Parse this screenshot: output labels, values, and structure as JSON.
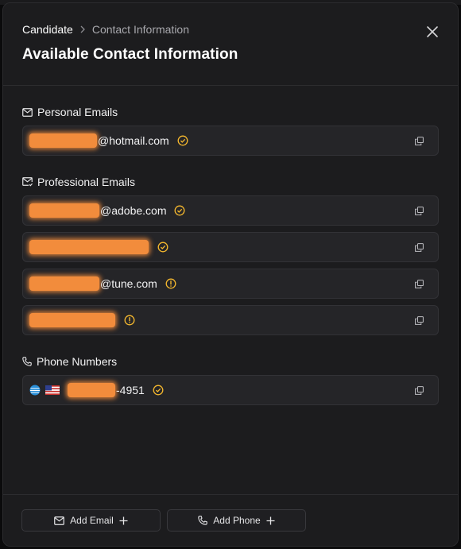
{
  "breadcrumb": {
    "root": "Candidate",
    "current": "Contact Information"
  },
  "title": "Available Contact Information",
  "sections": {
    "personal": {
      "title": "Personal Emails",
      "icon": "mail-icon",
      "items": [
        {
          "suffix": "@hotmail.com",
          "status": "verified"
        }
      ]
    },
    "professional": {
      "title": "Professional Emails",
      "icon": "mail-check-icon",
      "items": [
        {
          "suffix": "@adobe.com",
          "status": "verified"
        },
        {
          "suffix": "",
          "status": "verified"
        },
        {
          "suffix": "@tune.com",
          "status": "warning"
        },
        {
          "suffix": "",
          "status": "warning"
        }
      ]
    },
    "phones": {
      "title": "Phone Numbers",
      "icon": "phone-icon",
      "items": [
        {
          "carrier": "att-logo",
          "country": "us-flag",
          "suffix": "-4951",
          "status": "verified"
        }
      ]
    }
  },
  "footer": {
    "add_email": "Add Email",
    "add_phone": "Add Phone"
  },
  "colors": {
    "accent": "#f5b82e",
    "redaction": "#f28c3c",
    "panel": "#1c1c1e",
    "row": "#252528"
  }
}
